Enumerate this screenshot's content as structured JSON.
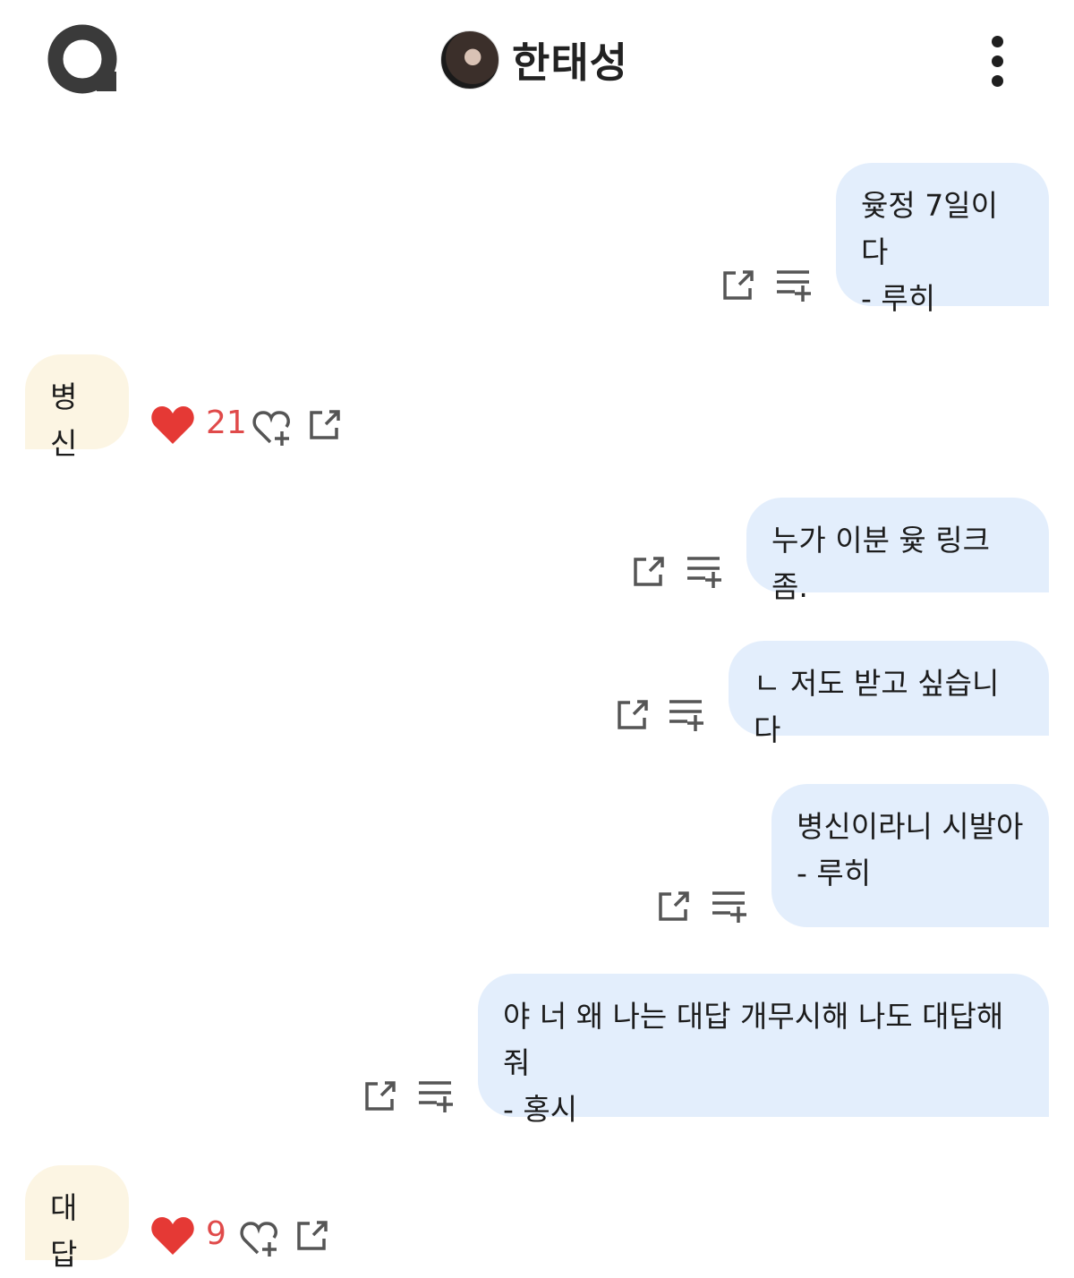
{
  "header": {
    "channel_name": "한태성"
  },
  "messages": [
    {
      "id": "m1",
      "side": "mine",
      "text": "윷정 7일이다\n- 루히"
    },
    {
      "id": "m2",
      "side": "theirs",
      "text": "병신",
      "likes": "21"
    },
    {
      "id": "m3",
      "side": "mine",
      "text": "누가 이분 윷 링크좀."
    },
    {
      "id": "m4",
      "side": "mine",
      "text": "ㄴ 저도 받고 싶습니다"
    },
    {
      "id": "m5",
      "side": "mine",
      "text": "병신이라니 시발아\n- 루히"
    },
    {
      "id": "m6",
      "side": "mine",
      "text": "야 너 왜 나는 대답 개무시해 나도 대답해줘\n- 홍시"
    },
    {
      "id": "m7",
      "side": "theirs",
      "text": "대답",
      "likes": "9"
    }
  ],
  "colors": {
    "mine_bubble": "#e3eefc",
    "theirs_bubble": "#fcf5e3",
    "heart": "#e53935",
    "icon": "#555555"
  }
}
